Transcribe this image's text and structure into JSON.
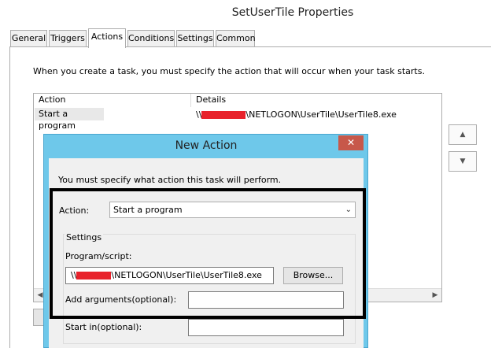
{
  "window": {
    "title": "SetUserTile Properties"
  },
  "tabs": [
    {
      "label": "General"
    },
    {
      "label": "Triggers"
    },
    {
      "label": "Actions"
    },
    {
      "label": "Conditions"
    },
    {
      "label": "Settings"
    },
    {
      "label": "Common"
    }
  ],
  "actions_tab": {
    "intro": "When you create a task, you must specify the action that will occur when your task starts.",
    "columns": {
      "action": "Action",
      "details": "Details"
    },
    "rows": [
      {
        "action": "Start a program",
        "details_prefix": "\\\\",
        "details_suffix": "\\NETLOGON\\UserTile\\UserTile8.exe"
      }
    ]
  },
  "dialog": {
    "title": "New Action",
    "close_glyph": "✕",
    "intro": "You must specify what action this task will perform.",
    "action_label": "Action:",
    "action_value": "Start a program",
    "settings_legend": "Settings",
    "program_label": "Program/script:",
    "program_prefix": "\\\\",
    "program_suffix": "\\NETLOGON\\UserTile\\UserTile8.exe",
    "browse_label": "Browse...",
    "args_label": "Add arguments(optional):",
    "args_value": "",
    "startin_label": "Start in(optional):",
    "startin_value": ""
  },
  "icons": {
    "move_up": "up-triangle",
    "move_down": "down-triangle",
    "dropdown": "chevron-down",
    "scroll_left": "left-triangle",
    "scroll_right": "right-triangle"
  },
  "colors": {
    "dialog_frame": "#6ec8ea",
    "close_button": "#c7584a",
    "redaction": "#e8222b",
    "highlight_border": "#000000"
  }
}
